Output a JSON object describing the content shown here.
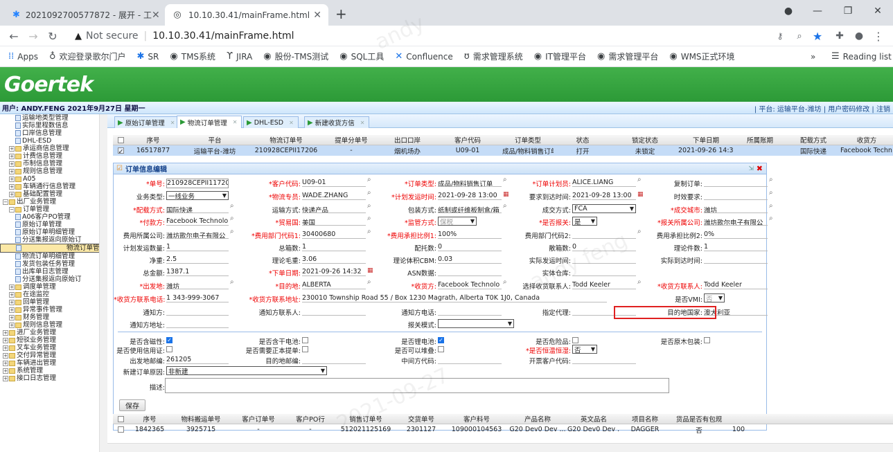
{
  "browser": {
    "tabs": [
      {
        "title": "2021092700577872 - 展开 - 工",
        "icon": "jira-icon"
      },
      {
        "title": "10.10.30.41/mainFrame.html",
        "icon": "globe-icon"
      }
    ],
    "url_prefix": "Not secure",
    "url": "10.10.30.41/mainFrame.html",
    "bookmarks": [
      "Apps",
      "欢迎登录歌尔门户",
      "SR",
      "TMS系统",
      "JIRA",
      "股份-TMS测试",
      "SQL工具",
      "Confluence",
      "需求管理系统",
      "IT管理平台",
      "需求管理平台",
      "WMS正式环境"
    ],
    "reading_list": "Reading list",
    "more": "»"
  },
  "app": {
    "logo": "Goertek",
    "user_info": "用户: ANDY.FENG 2021年9月27日 星期一",
    "right_links": "| 平台: 运输平台-潍坊 | 用户密码修改 | 注销"
  },
  "sidebar": [
    "运输地类型管理",
    "实际里程数信息",
    "口岸信息管理",
    "DHL-ESD",
    "承运商信息管理",
    "计费信息管理",
    "币制信息管理",
    "规则信息管理",
    "A05",
    "车辆通行信息管理",
    "基础配置管理",
    "出厂业务管理",
    "订单管理",
    "A06客户PO管理",
    "原始订单管理",
    "原始订单明细管理",
    "分送集报返向原始订",
    "物流订单管理",
    "物流订单明细管理",
    "发货包装任务管理",
    "出库单日志管理",
    "分送集报返向原始订",
    "调度单管理",
    "在途监控",
    "回单管理",
    "异常事件管理",
    "财务管理",
    "规则信息管理",
    "进厂业务管理",
    "短驳业务管理",
    "叉车业务管理",
    "交付异常管理",
    "车辆进出管理",
    "系统管理",
    "接口日志管理"
  ],
  "tabs": [
    "原始订单管理",
    "物流订单管理",
    "DHL-ESD",
    "新建收货方信"
  ],
  "grid": {
    "headers": [
      "序号",
      "平台",
      "物流订单号",
      "提单分单号",
      "出口口岸",
      "客户代码",
      "订单类型",
      "状态",
      "锁定状态",
      "下单日期",
      "所属账期",
      "配载方式",
      "收货方"
    ],
    "row": [
      "16517877",
      "运输平台-潍坊",
      "210928CEPII17206",
      "-",
      "烟机场办",
      "U09-01",
      "成品/物料销售订单",
      "打开",
      "未锁定",
      "2021-09-26 14:32",
      "",
      "国际快递",
      "Facebook Techn..."
    ]
  },
  "form": {
    "title": "订单信息编辑",
    "fields": {
      "order_no": {
        "label": "*单号:",
        "value": "210928CEPII11720"
      },
      "customer_code": {
        "label": "*客户代码:",
        "value": "U09-01"
      },
      "order_type": {
        "label": "*订单类型:",
        "value": "成品/物料销售订单"
      },
      "planner": {
        "label": "*订单计划员:",
        "value": "ALICE.LIANG"
      },
      "copy_order": {
        "label": "复制订单:",
        "value": ""
      },
      "biz_type": {
        "label": "业务类型:",
        "value": "一线业务"
      },
      "logistics_specialist": {
        "label": "*物流专员:",
        "value": "WADE.ZHANG"
      },
      "plan_ship_time": {
        "label": "*计划发运时间:",
        "value": "2021-09-28 13:00"
      },
      "req_arrive_time": {
        "label": "要求到达时间:",
        "value": "2021-09-28 13:00"
      },
      "time_req": {
        "label": "时效要求:",
        "value": ""
      },
      "load_method": {
        "label": "*配载方式:",
        "value": "国际快递"
      },
      "transport_method": {
        "label": "运输方式:",
        "value": "快递产品"
      },
      "package_method": {
        "label": "包装方式:",
        "value": "纸制或纤维板制盒/箱"
      },
      "deal_method": {
        "label": "成交方式:",
        "value": "FCA"
      },
      "deal_city": {
        "label": "*成交城市:",
        "value": "潍坊"
      },
      "payer": {
        "label": "*付款方:",
        "value": "Facebook Technolo"
      },
      "trade_country": {
        "label": "*贸易国:",
        "value": "美国"
      },
      "supervise_method": {
        "label": "*监管方式:",
        "value": "保税"
      },
      "declare": {
        "label": "*是否报关:",
        "value": "是"
      },
      "declare_company": {
        "label": "*报关所属公司:",
        "value": "潍坊歌尔电子有限公"
      },
      "cost_company": {
        "label": "费用所属公司:",
        "value": "潍坊歌尔电子有限公"
      },
      "cost_dept1": {
        "label": "*费用部门代码1:",
        "value": "30400680"
      },
      "cost_ratio1": {
        "label": "*费用承担比例1:",
        "value": "100%"
      },
      "cost_dept2": {
        "label": "费用部门代码2:",
        "value": ""
      },
      "cost_ratio2": {
        "label": "费用承担比例2:",
        "value": "0%"
      },
      "plan_qty": {
        "label": "计划发运数量:",
        "value": "1"
      },
      "total_boxes": {
        "label": "总箱数:",
        "value": "1"
      },
      "pallets": {
        "label": "配托数:",
        "value": "0"
      },
      "loose_boxes": {
        "label": "散箱数:",
        "value": "0"
      },
      "theory_pieces": {
        "label": "理论件数:",
        "value": "1"
      },
      "net_weight": {
        "label": "净重:",
        "value": "2.5"
      },
      "theory_gross": {
        "label": "理论毛重:",
        "value": "3.06"
      },
      "theory_cbm": {
        "label": "理论体积CBM:",
        "value": "0.03"
      },
      "actual_arrive": {
        "label": "实际到达时间:",
        "value": ""
      },
      "actual_ship": {
        "label": "实际发运时间:",
        "value": ""
      },
      "total_amount": {
        "label": "总金额:",
        "value": "1387.1"
      },
      "order_date": {
        "label": "*下单日期:",
        "value": "2021-09-26 14:32"
      },
      "asn": {
        "label": "ASN数据:",
        "value": ""
      },
      "real_warehouse": {
        "label": "实体仓库:",
        "value": ""
      },
      "origin": {
        "label": "*出发地:",
        "value": "潍坊"
      },
      "destination": {
        "label": "*目的地:",
        "value": "ALBERTA"
      },
      "consignee": {
        "label": "*收货方:",
        "value": "Facebook Technolo"
      },
      "select_contact": {
        "label": "选择收货联系人:",
        "value": "Todd Keeler"
      },
      "consignee_contact": {
        "label": "*收货方联系人:",
        "value": "Todd Keeler"
      },
      "consignee_phone": {
        "label": "*收货方联系电话:",
        "value": "1 343-999-3067"
      },
      "consignee_address": {
        "label": "*收货方联系地址:",
        "value": "230010 Township Road 55 / Box 1230 Magrath, Alberta  T0K 1J0, Canada"
      },
      "vmi": {
        "label": "是否VMI:",
        "value": "否"
      },
      "notify_party": {
        "label": "通知方:",
        "value": ""
      },
      "notify_contact": {
        "label": "通知方联系人:",
        "value": ""
      },
      "notify_phone": {
        "label": "通知方电话:",
        "value": ""
      },
      "agent": {
        "label": "指定代理:",
        "value": ""
      },
      "dest_country": {
        "label": "目的地国家:",
        "value": "澳大利亚"
      },
      "notify_address": {
        "label": "通知方地址:",
        "value": ""
      },
      "declare_mode": {
        "label": "报关模式:",
        "value": ""
      },
      "sensitive": {
        "label": "是否含磁性:",
        "checked": true
      },
      "dry_battery": {
        "label": "是否含干电池:",
        "checked": false
      },
      "lithium": {
        "label": "是否锂电池:",
        "checked": true
      },
      "dangerous": {
        "label": "是否危险品:",
        "checked": false
      },
      "wood": {
        "label": "是否原木包装:",
        "checked": false
      },
      "credit_cert": {
        "label": "是否使用信用证:",
        "checked": false
      },
      "original_bill": {
        "label": "是否需要正本提单:",
        "checked": false
      },
      "stackable": {
        "label": "是否可以堆叠:",
        "checked": false
      },
      "temp_control": {
        "label": "*是否恒温恒湿:",
        "value": "否"
      },
      "origin_zip": {
        "label": "出发地邮编:",
        "value": "261205"
      },
      "dest_zip": {
        "label": "目的地邮编:",
        "value": ""
      },
      "transit_code": {
        "label": "中间方代码:",
        "value": ""
      },
      "ticket_customer": {
        "label": "开票客户代码:",
        "value": ""
      },
      "new_reason": {
        "label": "新建订单原因:",
        "value": "非新建"
      },
      "desc": {
        "label": "描述:",
        "value": ""
      }
    },
    "save": "保存"
  },
  "detail_grid": {
    "headers": [
      "序号",
      "物料搬运单号",
      "客户订单号",
      "客户PO行",
      "销售订单号",
      "交货单号",
      "客户料号",
      "产品名称",
      "英文品名",
      "项目名称",
      "货品是否有包规"
    ],
    "row": [
      "1842365",
      "3925715",
      "-",
      "-",
      "512021125169",
      "2301127",
      "109000104563",
      "G20 Dev0 Dev ...",
      "G20 Dev0 Dev ...",
      "DAGGER",
      "否",
      "100"
    ]
  }
}
